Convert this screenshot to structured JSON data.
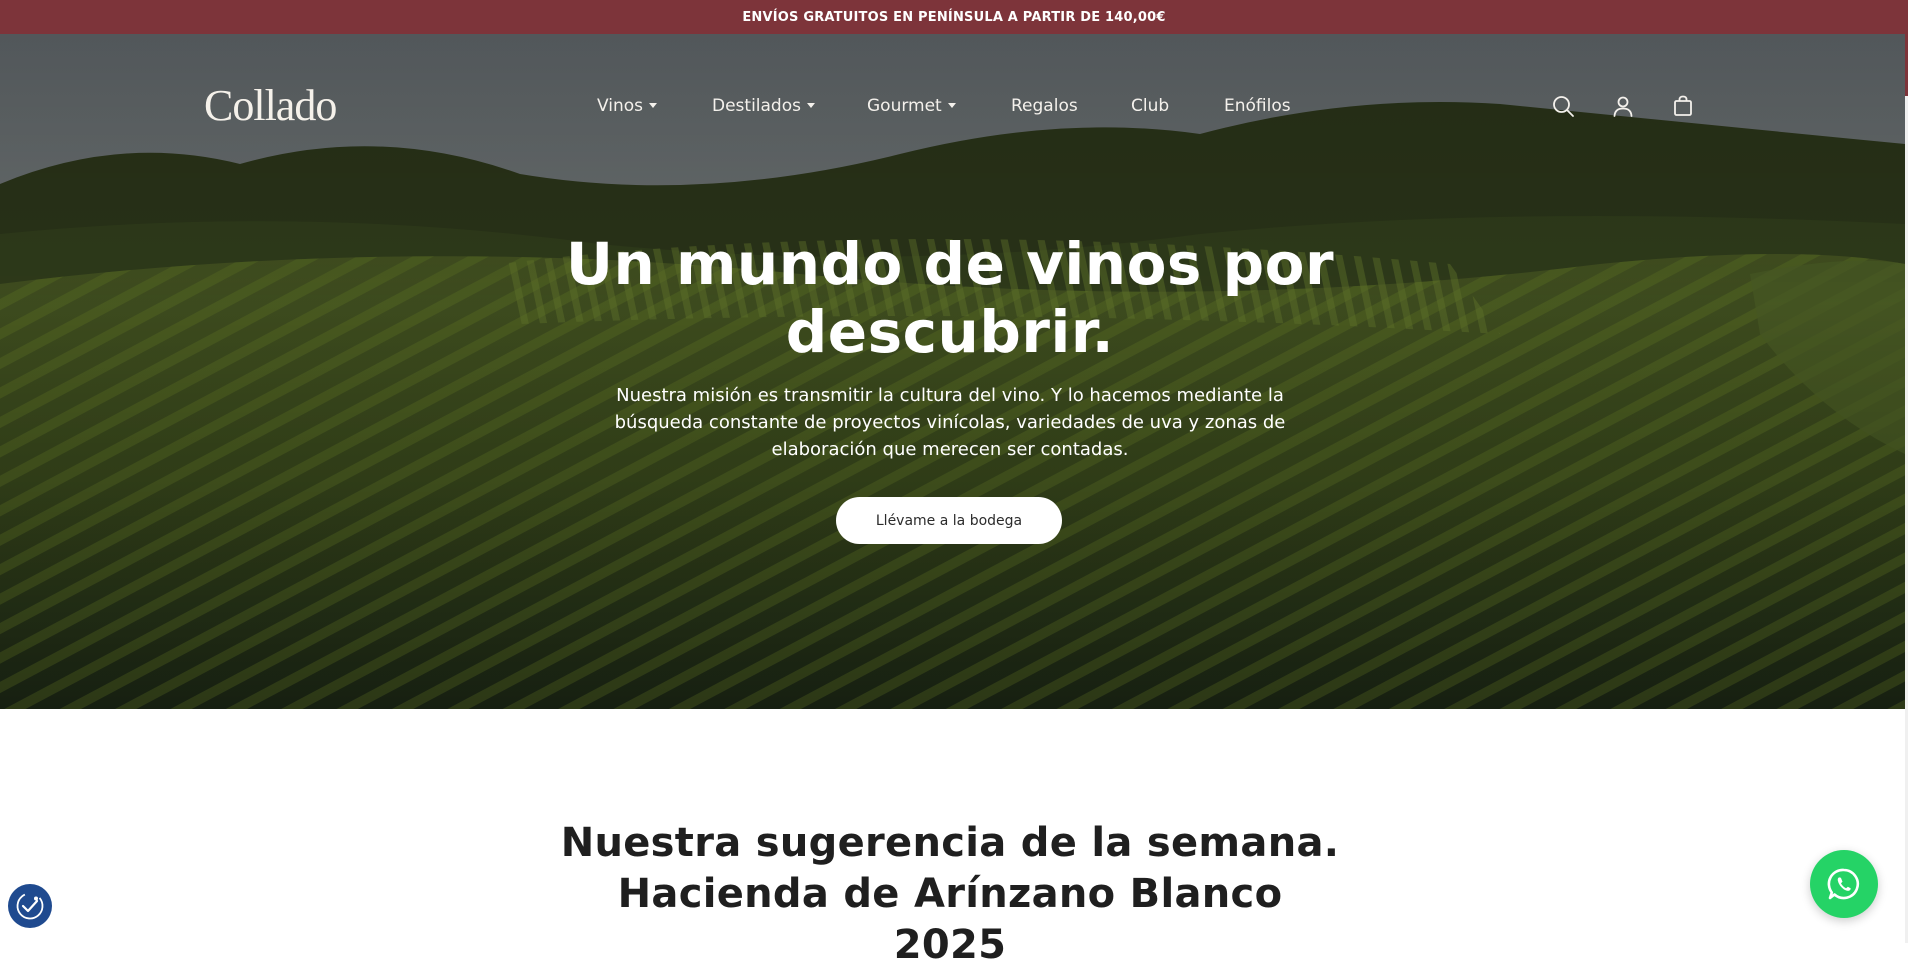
{
  "announcement": {
    "text": "ENVÍOS GRATUITOS EN PENÍNSULA A PARTIR DE 140,00€"
  },
  "header": {
    "logo_text": "Collado",
    "nav": [
      {
        "label": "Vinos",
        "has_dropdown": true
      },
      {
        "label": "Destilados",
        "has_dropdown": true
      },
      {
        "label": "Gourmet",
        "has_dropdown": true
      },
      {
        "label": "Regalos",
        "has_dropdown": false
      },
      {
        "label": "Club",
        "has_dropdown": false
      },
      {
        "label": "Enófilos",
        "has_dropdown": false
      }
    ],
    "icons": [
      "search-icon",
      "account-icon",
      "cart-icon"
    ]
  },
  "hero": {
    "title": "Un mundo de vinos por descubrir.",
    "subtitle": "Nuestra misión es transmitir la cultura del vino. Y lo hacemos mediante la búsqueda constante de proyectos vinícolas, variedades de uva y zonas de elaboración que merecen ser contadas.",
    "cta_label": "Llévame a la bodega"
  },
  "suggestion": {
    "title": "Nuestra sugerencia de la semana. Hacienda de Arínzano Blanco 2025"
  },
  "floating": {
    "accessibility_icon": "accessibility-icon",
    "whatsapp_icon": "whatsapp-icon"
  },
  "colors": {
    "announcement_bg": "#7d343a",
    "whatsapp": "#25d366",
    "accessibility": "#1f4a8f"
  }
}
